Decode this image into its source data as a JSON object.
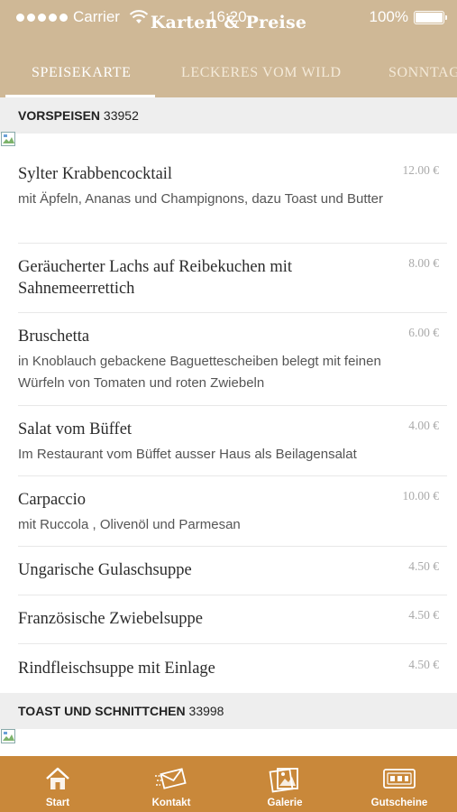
{
  "status": {
    "carrier": "Carrier",
    "time": "16:20",
    "battery": "100%"
  },
  "title": "Karten & Preise",
  "tabs": [
    {
      "label": "SPEISEKARTE",
      "active": true
    },
    {
      "label": "LECKERES VOM WILD",
      "active": false
    },
    {
      "label": "SONNTAGSBRATEN",
      "active": false
    }
  ],
  "sections": [
    {
      "title": "VORSPEISEN",
      "id": "33952"
    },
    {
      "title": "TOAST UND SCHNITTCHEN",
      "id": "33998"
    }
  ],
  "items": [
    {
      "name": "Sylter Krabbencocktail",
      "desc": "mit Äpfeln, Ananas und Champignons, dazu Toast und Butter",
      "price": "12.00 €"
    },
    {
      "name": "Geräucherter Lachs auf Reibekuchen mit Sahnemeerrettich",
      "desc": "",
      "price": "8.00 €"
    },
    {
      "name": "Bruschetta",
      "desc": "in Knoblauch gebackene Baguettescheiben belegt mit feinen Würfeln von Tomaten und roten Zwiebeln",
      "price": "6.00 €"
    },
    {
      "name": "Salat vom Büffet",
      "desc": "Im Restaurant vom Büffet ausser Haus als Beilagensalat",
      "price": "4.00 €"
    },
    {
      "name": "Carpaccio",
      "desc": "mit Ruccola , Olivenöl und Parmesan",
      "price": "10.00 €"
    },
    {
      "name": "Ungarische Gulaschsuppe",
      "desc": "",
      "price": "4.50 €"
    },
    {
      "name": "Französische Zwiebelsuppe",
      "desc": "",
      "price": "4.50 €"
    },
    {
      "name": "Rindfleischsuppe mit Einlage",
      "desc": "",
      "price": "4.50 €"
    }
  ],
  "bottom_tabs": [
    {
      "label": "Start",
      "icon": "home-icon"
    },
    {
      "label": "Kontakt",
      "icon": "mail-icon"
    },
    {
      "label": "Galerie",
      "icon": "gallery-icon"
    },
    {
      "label": "Gutscheine",
      "icon": "voucher-icon"
    }
  ],
  "colors": {
    "header": "#cfb896",
    "bottom_bar": "#c9883a",
    "section_bg": "#eeeeee"
  }
}
